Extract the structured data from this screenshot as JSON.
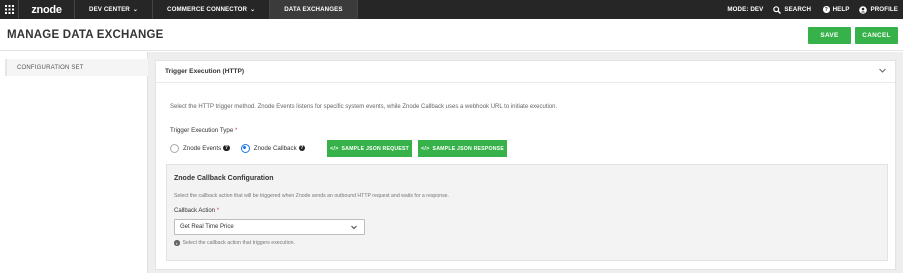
{
  "nav": {
    "logo": "znode",
    "items": [
      {
        "label": "DEV CENTER",
        "chevron": "⌄"
      },
      {
        "label": "COMMERCE CONNECTOR",
        "chevron": "⌄"
      },
      {
        "label": "DATA EXCHANGES"
      }
    ],
    "mode": "MODE: DEV",
    "search": "SEARCH",
    "help": "HELP",
    "profile": "PROFILE"
  },
  "header": {
    "title": "MANAGE DATA EXCHANGE",
    "save_label": "SAVE",
    "cancel_label": "CANCEL"
  },
  "sidebar": {
    "items": [
      {
        "label": "CONFIGURATION SET"
      }
    ]
  },
  "panel": {
    "title": "Trigger Execution (HTTP)",
    "description": "Select the HTTP trigger method. Znode Events listens for specific system events, while Znode Callback uses a webhook URL to initiate execution.",
    "trigger_label": "Trigger Execution Type",
    "required_mark": "*",
    "options": [
      {
        "label": "Znode Events",
        "selected": false
      },
      {
        "label": "Znode Callback",
        "selected": true
      }
    ],
    "sample_request_label": "SAMPLE JSON REQUEST",
    "sample_response_label": "SAMPLE JSON RESPONSE",
    "code_icon": "</>"
  },
  "callback": {
    "title": "Znode Callback Configuration",
    "description": "Select the callback action that will be triggered when Znode sends an outbound HTTP request and waits for a response.",
    "action_label": "Callback Action",
    "required_mark": "*",
    "selected_value": "Get Real Time Price",
    "hint": "Select the callback action that triggers execution."
  },
  "colors": {
    "accent_green": "#37b24a",
    "nav_bg": "#262626",
    "radio_blue": "#1a73e8"
  }
}
